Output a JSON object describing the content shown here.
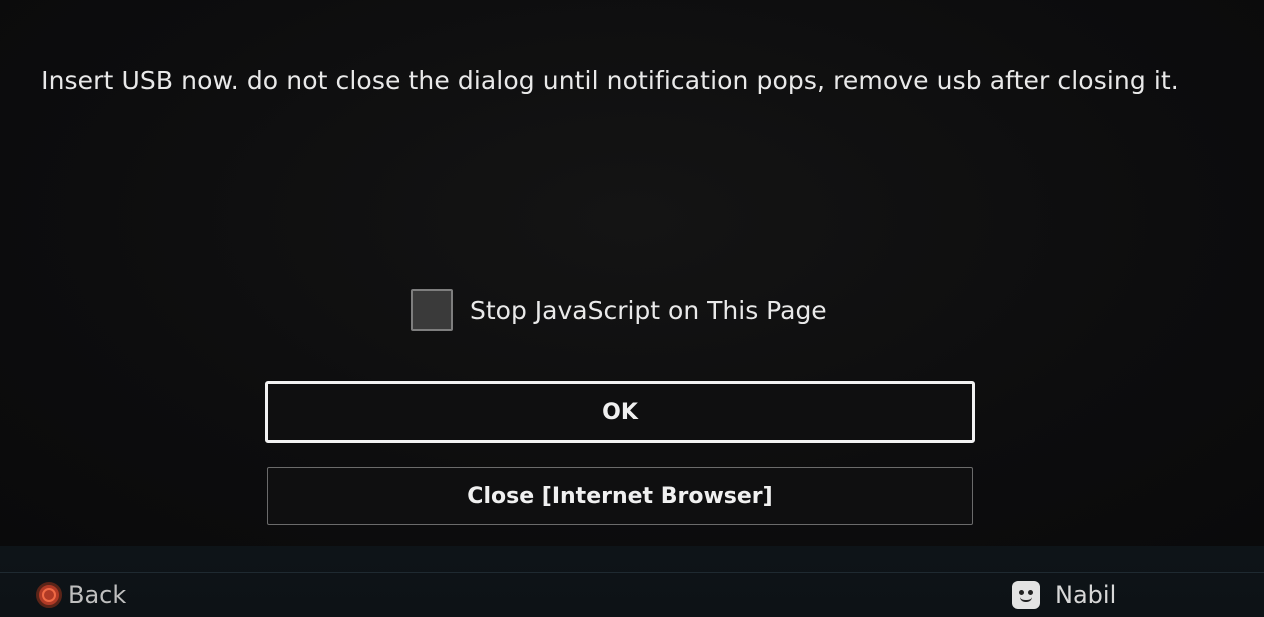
{
  "dialog": {
    "message": "Insert USB now. do not close the dialog until notification pops, remove usb after closing it.",
    "checkbox": {
      "label": "Stop JavaScript on This Page",
      "checked": false
    },
    "buttons": {
      "ok_label": "OK",
      "close_label": "Close [Internet Browser]"
    }
  },
  "bottom_bar": {
    "back_label": "Back",
    "back_icon": "circle-button-icon",
    "user_name": "Nabil",
    "user_icon": "avatar-icon"
  },
  "colors": {
    "background": "#0b0b0c",
    "text": "#e9e9e9",
    "focus_border": "#f2f2f2",
    "circle_button": "#b03a26"
  }
}
